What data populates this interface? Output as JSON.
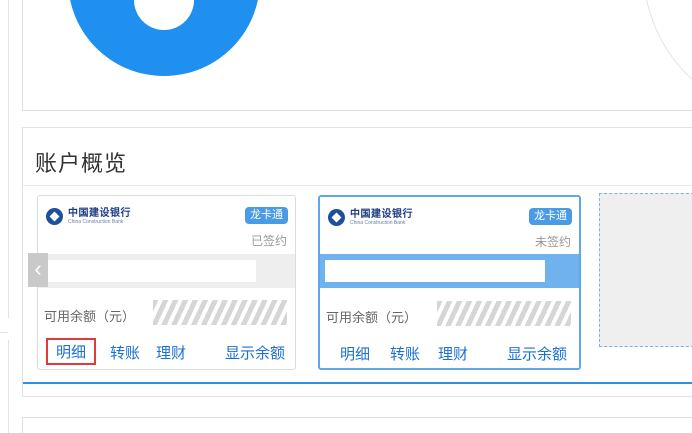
{
  "overview": {
    "title": "账户概览"
  },
  "cards": [
    {
      "bank_name_cn": "中国建设银行",
      "bank_name_en": "China Construction Bank",
      "card_type": "龙卡通",
      "sign_status": "已签约",
      "balance_label": "可用余额（元）",
      "actions": {
        "detail": "明细",
        "transfer": "转账",
        "finance": "理财",
        "show_balance": "显示余额"
      }
    },
    {
      "bank_name_cn": "中国建设银行",
      "bank_name_en": "China Construction Bank",
      "card_type": "龙卡通",
      "sign_status": "未签约",
      "balance_label": "可用余额（元）",
      "actions": {
        "detail": "明细",
        "transfer": "转账",
        "finance": "理财",
        "show_balance": "显示余额"
      }
    }
  ],
  "icons": {
    "prev": "chevron-left-icon",
    "bank": "ccb-logo-icon"
  },
  "colors": {
    "accent": "#2f8fe3",
    "avatar": "#1f8ff0",
    "link": "#1b6fd1",
    "highlight": "#e03a3a"
  }
}
